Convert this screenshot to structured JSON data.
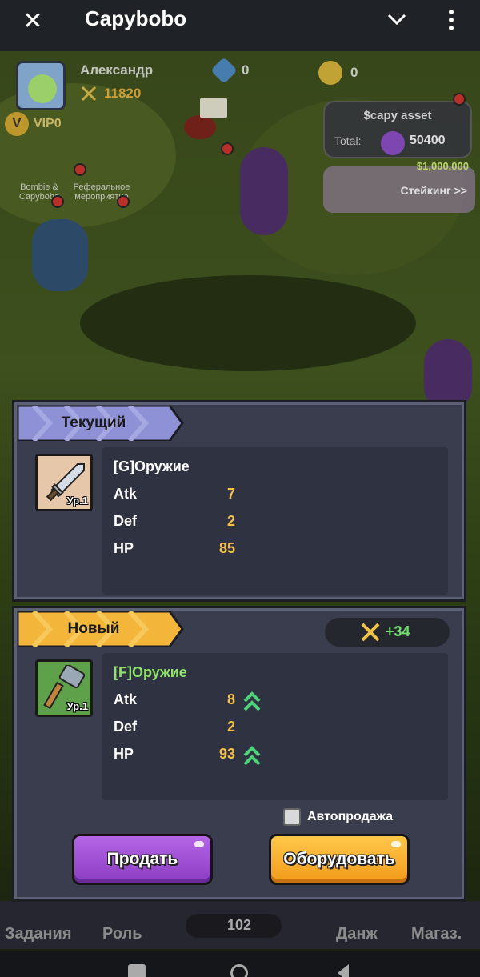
{
  "app_bar": {
    "title": "Capybobo"
  },
  "hud": {
    "player_name": "Александр",
    "power": "11820",
    "gems": "0",
    "coins": "0",
    "vip": "VIP0",
    "shortcut_capy": "Bombie & Capybobo",
    "shortcut_referral": "Реферальное мероприятие",
    "asset_title": "$capy asset",
    "asset_total_label": "Total:",
    "asset_total_value": "50400",
    "staking_amount": "$1,000,000",
    "staking_label": "Стейкинг >>"
  },
  "current": {
    "ribbon": "Текущий",
    "level": "Ур.1",
    "name": "[G]Оружие",
    "name_color": "#ffffff",
    "stats": [
      {
        "key": "Atk",
        "value": "7"
      },
      {
        "key": "Def",
        "value": "2"
      },
      {
        "key": "HP",
        "value": "85"
      }
    ]
  },
  "new": {
    "ribbon": "Новый",
    "power_delta": "+34",
    "level": "Ур.1",
    "name": "[F]Оружие",
    "name_color": "#8fe36a",
    "stats": [
      {
        "key": "Atk",
        "value": "8",
        "up": true
      },
      {
        "key": "Def",
        "value": "2",
        "up": false
      },
      {
        "key": "HP",
        "value": "93",
        "up": true
      }
    ]
  },
  "auto_sell_label": "Автопродажа",
  "sell_button": "Продать",
  "equip_button": "Оборудовать",
  "nav": {
    "tasks": "Задания",
    "role": "Роль",
    "carrots": "102",
    "dungeon": "Данж",
    "shop": "Магаз."
  },
  "colors": {
    "accent_green": "#6ee06a",
    "stat_value": "#f4c14d",
    "sell": "#9b4dd6",
    "equip": "#f5a623"
  }
}
